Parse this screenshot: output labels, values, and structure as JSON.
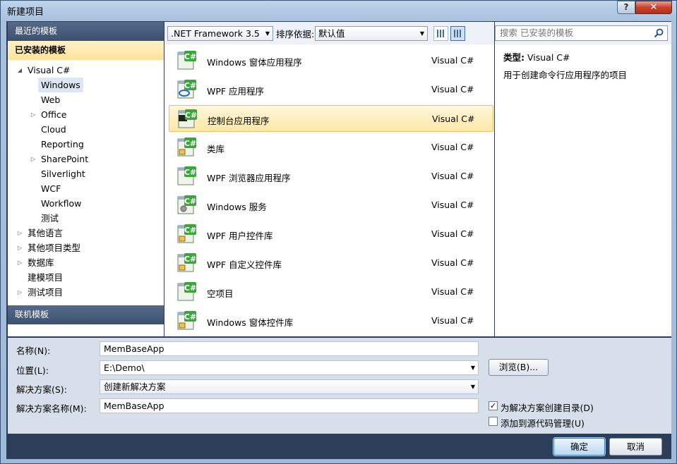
{
  "window": {
    "title": "新建项目",
    "help": "?",
    "close": "✕"
  },
  "left": {
    "recent": "最近的模板",
    "installed": "已安装的模板",
    "online": "联机模板",
    "tree": [
      {
        "label": "Visual C#",
        "indent": 0,
        "arrow": "◢"
      },
      {
        "label": "Windows",
        "indent": 1,
        "arrow": "",
        "selected": true
      },
      {
        "label": "Web",
        "indent": 1,
        "arrow": ""
      },
      {
        "label": "Office",
        "indent": 1,
        "arrow": "▷"
      },
      {
        "label": "Cloud",
        "indent": 1,
        "arrow": ""
      },
      {
        "label": "Reporting",
        "indent": 1,
        "arrow": ""
      },
      {
        "label": "SharePoint",
        "indent": 1,
        "arrow": "▷"
      },
      {
        "label": "Silverlight",
        "indent": 1,
        "arrow": ""
      },
      {
        "label": "WCF",
        "indent": 1,
        "arrow": ""
      },
      {
        "label": "Workflow",
        "indent": 1,
        "arrow": ""
      },
      {
        "label": "测试",
        "indent": 1,
        "arrow": ""
      },
      {
        "label": "其他语言",
        "indent": 0,
        "arrow": "▷"
      },
      {
        "label": "其他项目类型",
        "indent": 0,
        "arrow": "▷"
      },
      {
        "label": "数据库",
        "indent": 0,
        "arrow": "▷"
      },
      {
        "label": "建模项目",
        "indent": 0,
        "arrow": ""
      },
      {
        "label": "测试项目",
        "indent": 0,
        "arrow": "▷"
      }
    ]
  },
  "toolbar": {
    "framework": ".NET Framework 3.5",
    "sort_label": "排序依据:",
    "sort_value": "默认值"
  },
  "templates": [
    {
      "name": "Windows 窗体应用程序",
      "type": "Visual C#",
      "icon": "winforms-app-icon"
    },
    {
      "name": "WPF 应用程序",
      "type": "Visual C#",
      "icon": "wpf-app-icon"
    },
    {
      "name": "控制台应用程序",
      "type": "Visual C#",
      "icon": "console-app-icon",
      "selected": true
    },
    {
      "name": "类库",
      "type": "Visual C#",
      "icon": "class-library-icon"
    },
    {
      "name": "WPF 浏览器应用程序",
      "type": "Visual C#",
      "icon": "wpf-browser-app-icon"
    },
    {
      "name": "Windows 服务",
      "type": "Visual C#",
      "icon": "windows-service-icon"
    },
    {
      "name": "WPF 用户控件库",
      "type": "Visual C#",
      "icon": "wpf-user-control-icon"
    },
    {
      "name": "WPF 自定义控件库",
      "type": "Visual C#",
      "icon": "wpf-custom-control-icon"
    },
    {
      "name": "空项目",
      "type": "Visual C#",
      "icon": "empty-project-icon"
    },
    {
      "name": "Windows 窗体控件库",
      "type": "Visual C#",
      "icon": "winforms-control-library-icon"
    }
  ],
  "search": {
    "placeholder": "搜索 已安装的模板"
  },
  "details": {
    "type_label": "类型:",
    "type_value": "Visual C#",
    "description": "用于创建命令行应用程序的项目"
  },
  "form": {
    "name_label": "名称(N):",
    "name_value": "MemBaseApp",
    "location_label": "位置(L):",
    "location_value": "E:\\Demo\\",
    "solution_label": "解决方案(S):",
    "solution_value": "创建新解决方案",
    "solution_name_label": "解决方案名称(M):",
    "solution_name_value": "MemBaseApp",
    "browse": "浏览(B)...",
    "create_dir": "为解决方案创建目录(D)",
    "create_dir_checked": true,
    "source_control": "添加到源代码管理(U)",
    "source_control_checked": false
  },
  "buttons": {
    "ok": "确定",
    "cancel": "取消"
  }
}
